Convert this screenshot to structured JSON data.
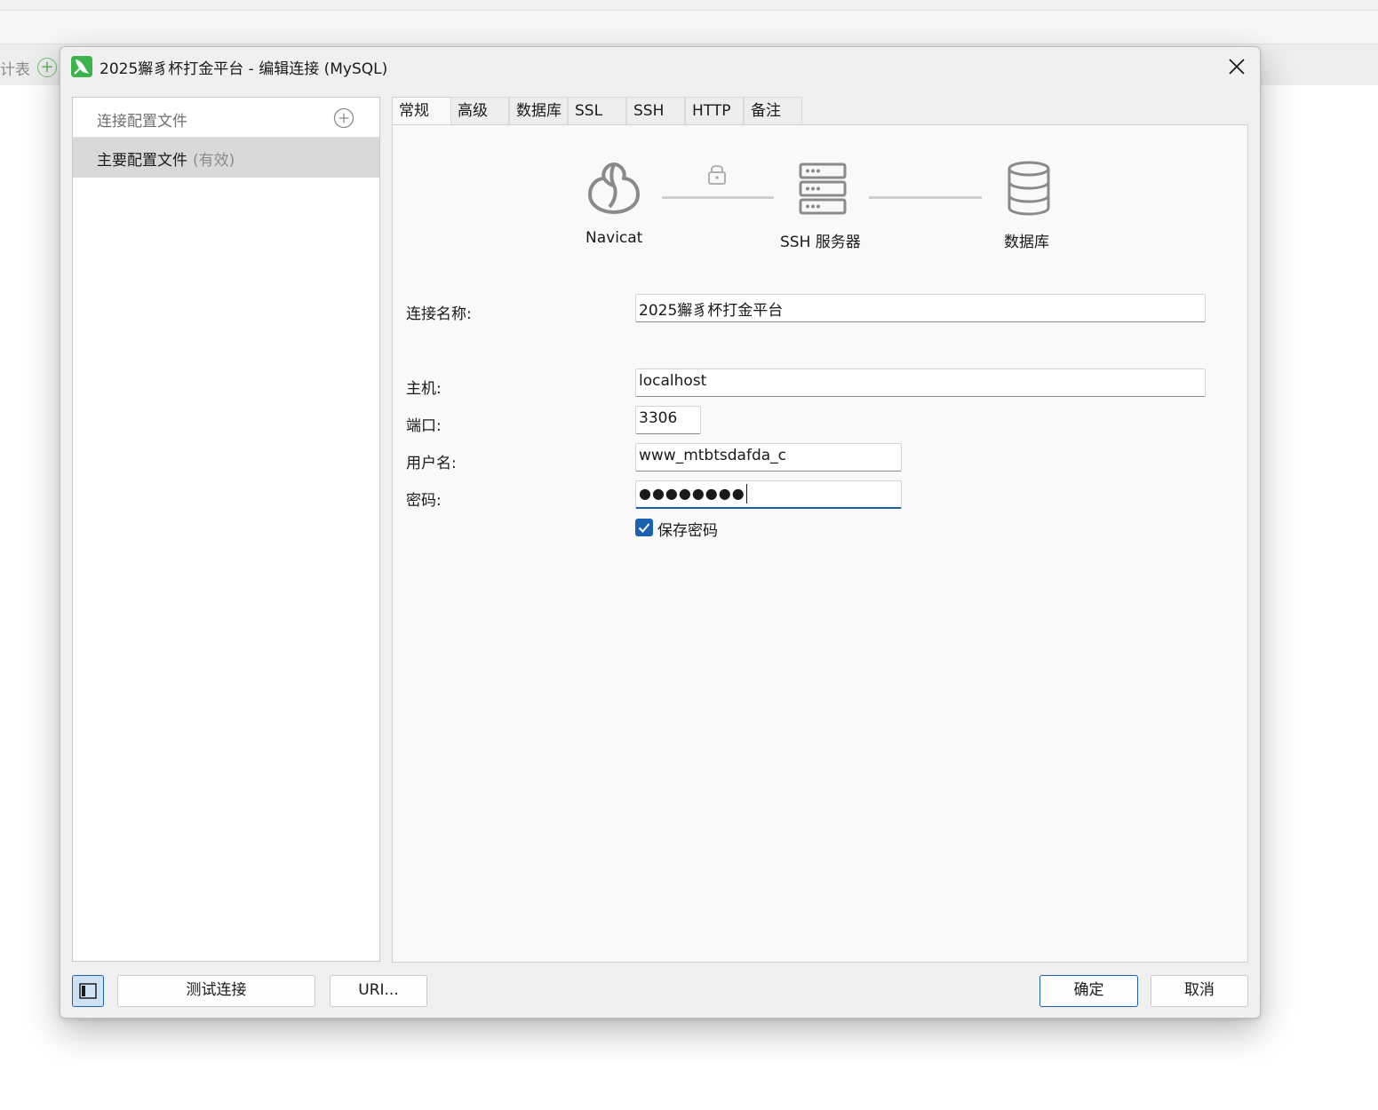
{
  "background_app": {
    "partial_tab_label": "计表",
    "add_tab_symbol": "+"
  },
  "dialog": {
    "title": "2025獬豸杯打金平台 - 编辑连接 (MySQL)",
    "close_symbol": "✕"
  },
  "profiles": {
    "header_label": "连接配置文件",
    "items": [
      {
        "label": "主要配置文件",
        "suffix": "(有效)"
      }
    ]
  },
  "tabs": [
    {
      "label": "常规",
      "active": true
    },
    {
      "label": "高级",
      "active": false
    },
    {
      "label": "数据库",
      "active": false
    },
    {
      "label": "SSL",
      "active": false
    },
    {
      "label": "SSH",
      "active": false
    },
    {
      "label": "HTTP",
      "active": false
    },
    {
      "label": "备注",
      "active": false
    }
  ],
  "diagram": {
    "navicat_label": "Navicat",
    "ssh_label": "SSH 服务器",
    "database_label": "数据库",
    "icons": [
      "navicat-icon",
      "lock-icon",
      "server-icon",
      "database-icon"
    ]
  },
  "form": {
    "connection_name_label": "连接名称:",
    "connection_name_value": "2025獬豸杯打金平台",
    "host_label": "主机:",
    "host_value": "localhost",
    "port_label": "端口:",
    "port_value": "3306",
    "username_label": "用户名:",
    "username_value": "www_mtbtsdafda_c",
    "password_label": "密码:",
    "password_masked": "●●●●●●●●",
    "save_password_label": "保存密码",
    "save_password_checked": true
  },
  "footer": {
    "test_connection_label": "测试连接",
    "uri_label": "URI...",
    "ok_label": "确定",
    "cancel_label": "取消"
  },
  "colors": {
    "accent": "#1a62b0",
    "app_icon": "#3cb44b"
  }
}
